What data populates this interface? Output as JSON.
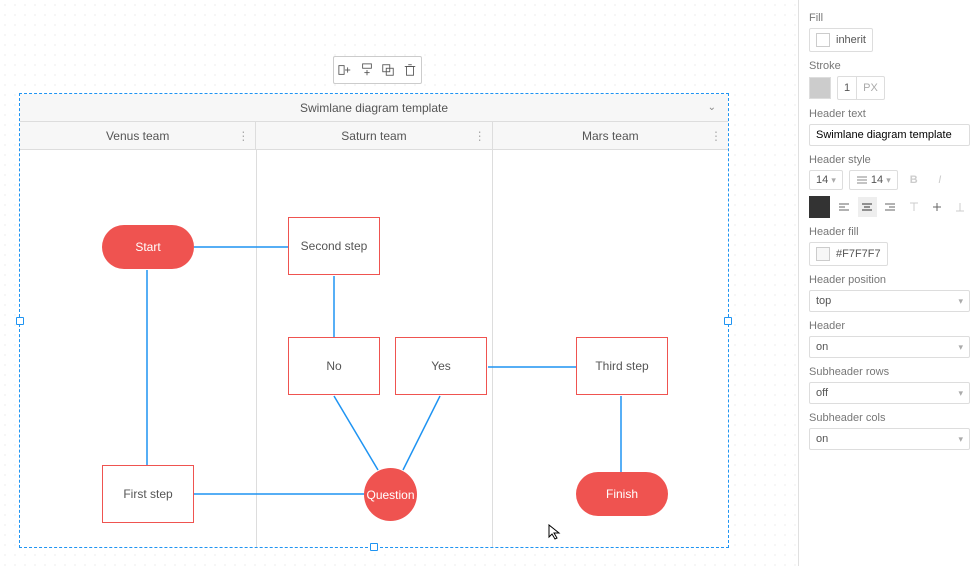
{
  "canvas": {
    "swimlane_title": "Swimlane diagram template",
    "columns": [
      "Venus team",
      "Saturn team",
      "Mars team"
    ],
    "nodes": {
      "start": "Start",
      "second_step": "Second step",
      "no": "No",
      "yes": "Yes",
      "third_step": "Third step",
      "first_step": "First step",
      "question": "Question",
      "finish": "Finish"
    }
  },
  "toolbar": {
    "icons": [
      "add-right-icon",
      "add-below-icon",
      "copy-icon",
      "delete-icon"
    ]
  },
  "panel": {
    "fill_label": "Fill",
    "fill_value": "inherit",
    "stroke_label": "Stroke",
    "stroke_width": "1",
    "stroke_unit": "PX",
    "header_text_label": "Header text",
    "header_text_value": "Swimlane diagram template",
    "header_style_label": "Header style",
    "font_size": "14",
    "line_height": "14",
    "header_fill_label": "Header fill",
    "header_fill_value": "#F7F7F7",
    "header_position_label": "Header position",
    "header_position_value": "top",
    "header_label": "Header",
    "header_value": "on",
    "subheader_rows_label": "Subheader rows",
    "subheader_rows_value": "off",
    "subheader_cols_label": "Subheader cols",
    "subheader_cols_value": "on"
  }
}
